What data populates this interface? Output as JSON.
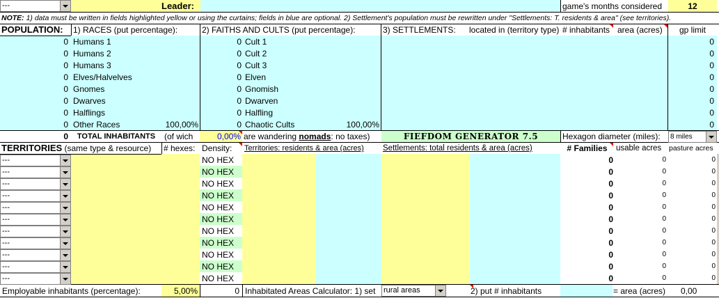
{
  "top": {
    "leader_combo": "---",
    "leader_label": "Leader:",
    "months_label": "game's months considered",
    "months_value": "12"
  },
  "note": {
    "prefix": "NOTE:",
    "text": " 1) data must be written in fields highlighted yellow or using the curtains; fields in blue are optional. 2) Settlement's population must be rewritten under \"Settlements: T. residents & area\" (see territories)."
  },
  "population": {
    "title": "POPULATION:",
    "races_header": "1) RACES (put percentage):",
    "faiths_header": "2) FAITHS AND CULTS (put percentage):",
    "races": [
      {
        "value": "0",
        "label": "Humans 1",
        "pct": ""
      },
      {
        "value": "0",
        "label": "Humans 2",
        "pct": ""
      },
      {
        "value": "0",
        "label": "Humans 3",
        "pct": ""
      },
      {
        "value": "0",
        "label": "Elves/Halvelves",
        "pct": ""
      },
      {
        "value": "0",
        "label": "Gnomes",
        "pct": ""
      },
      {
        "value": "0",
        "label": "Dwarves",
        "pct": ""
      },
      {
        "value": "0",
        "label": "Halflings",
        "pct": ""
      },
      {
        "value": "0",
        "label": "Other Races",
        "pct": "100,00%"
      }
    ],
    "faiths": [
      {
        "value": "0",
        "label": "Cult 1",
        "pct": ""
      },
      {
        "value": "0",
        "label": "Cult 2",
        "pct": ""
      },
      {
        "value": "0",
        "label": "Cult 3",
        "pct": ""
      },
      {
        "value": "0",
        "label": "Elven",
        "pct": ""
      },
      {
        "value": "0",
        "label": "Gnomish",
        "pct": ""
      },
      {
        "value": "0",
        "label": "Dwarven",
        "pct": ""
      },
      {
        "value": "0",
        "label": "Halfling",
        "pct": ""
      },
      {
        "value": "0",
        "label": "Chaotic Cults",
        "pct": "100,00%"
      }
    ],
    "total_value": "0",
    "total_label": "TOTAL INHABITANTS",
    "of_which": "(of wich",
    "nomad_pct": "0,00%",
    "nomad_text_1": "are wandering ",
    "nomad_word": "nomads",
    "nomad_text_2": ": no taxes)"
  },
  "settlements": {
    "header": "3) SETTLEMENTS:",
    "located": "located in (territory type)",
    "inhabitants": "# inhabitants",
    "area": "area (acres)",
    "gp_limit": "gp limit",
    "gp_values": [
      "0",
      "0",
      "0",
      "0",
      "0",
      "0",
      "0",
      "0"
    ]
  },
  "generator": {
    "title": "FIEFDOM GENERATOR 7.5",
    "hex_label": "Hexagon diameter (miles):",
    "hex_value": "8 miles"
  },
  "territories": {
    "title": "TERRITORIES",
    "subtitle": "(same type & resource)",
    "hexes": "# hexes:",
    "density": "Density:",
    "res_area": "Territories: residents & area (acres)",
    "settle_area": "Settlements: total residents & area (acres)",
    "families": "# Families",
    "usable": "usable acres",
    "pasture": "pasture acres",
    "rows": [
      {
        "type": "---",
        "density": "NO HEX",
        "families": "0",
        "usable": "0",
        "pasture": "0"
      },
      {
        "type": "---",
        "density": "NO HEX",
        "families": "0",
        "usable": "0",
        "pasture": "0"
      },
      {
        "type": "---",
        "density": "NO HEX",
        "families": "0",
        "usable": "0",
        "pasture": "0"
      },
      {
        "type": "---",
        "density": "NO HEX",
        "families": "0",
        "usable": "0",
        "pasture": "0"
      },
      {
        "type": "---",
        "density": "NO HEX",
        "families": "0",
        "usable": "0",
        "pasture": "0"
      },
      {
        "type": "---",
        "density": "NO HEX",
        "families": "0",
        "usable": "0",
        "pasture": "0"
      },
      {
        "type": "---",
        "density": "NO HEX",
        "families": "0",
        "usable": "0",
        "pasture": "0"
      },
      {
        "type": "---",
        "density": "NO HEX",
        "families": "0",
        "usable": "0",
        "pasture": "0"
      },
      {
        "type": "---",
        "density": "NO HEX",
        "families": "0",
        "usable": "0",
        "pasture": "0"
      },
      {
        "type": "---",
        "density": "NO HEX",
        "families": "0",
        "usable": "0",
        "pasture": "0"
      },
      {
        "type": "---",
        "density": "NO HEX",
        "families": "0",
        "usable": "0",
        "pasture": "0"
      }
    ]
  },
  "bottom": {
    "employable_label": "Employable inhabitants (percentage):",
    "employable_pct": "5,00%",
    "employable_value": "0",
    "calc_label": "Inhabitated Areas Calculator: 1) set",
    "calc_combo": "rural areas",
    "put_label": "2) put # inhabitants",
    "area_label": "= area (acres)",
    "area_value": "0,00"
  },
  "colors": {
    "yellow": "#ffff99",
    "cyan": "#ccffff",
    "green": "#ccffcc",
    "tri": "#ff0000"
  }
}
